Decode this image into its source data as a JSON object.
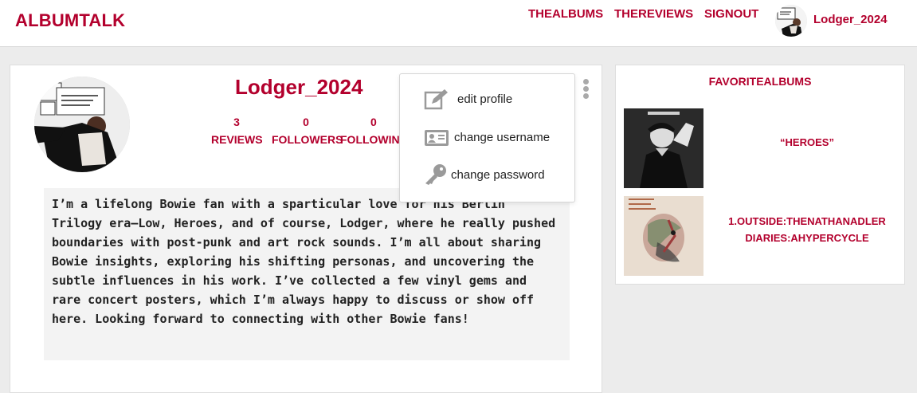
{
  "brand": {
    "name": "ALBUMTALK"
  },
  "nav": {
    "links": [
      "THEALBUMS",
      "THEREVIEWS",
      "SIGNOUT"
    ],
    "user": "Lodger_2024"
  },
  "profile": {
    "username": "Lodger_2024",
    "stats": [
      {
        "count": "3",
        "label": "REVIEWS"
      },
      {
        "count": "0",
        "label": "FOLLOWERS"
      },
      {
        "count": "0",
        "label": "FOLLOWING"
      }
    ],
    "bio": "I’m a lifelong Bowie fan with a sparticular love for his Berlin Trilogy era—Low, Heroes, and of course, Lodger, where he really pushed boundaries with post-punk and art rock sounds. I’m all about sharing Bowie insights, exploring his shifting personas, and uncovering the subtle influences in his work. I’ve collected a few vinyl gems and rare concert posters, which I’m always happy to discuss or show off here. Looking forward to connecting with other Bowie fans!"
  },
  "menu": {
    "items": [
      {
        "label": "edit profile",
        "icon": "edit-icon"
      },
      {
        "label": "change username",
        "icon": "id-card-icon"
      },
      {
        "label": "change password",
        "icon": "key-icon"
      }
    ]
  },
  "favorites": {
    "title": "FAVORITEALBUMS",
    "albums": [
      {
        "title": "“HEROES”"
      },
      {
        "title": "1.OUTSIDE:THENATHANADLER DIARIES:AHYPERCYCLE"
      }
    ]
  },
  "colors": {
    "accent": "#b3002d"
  }
}
